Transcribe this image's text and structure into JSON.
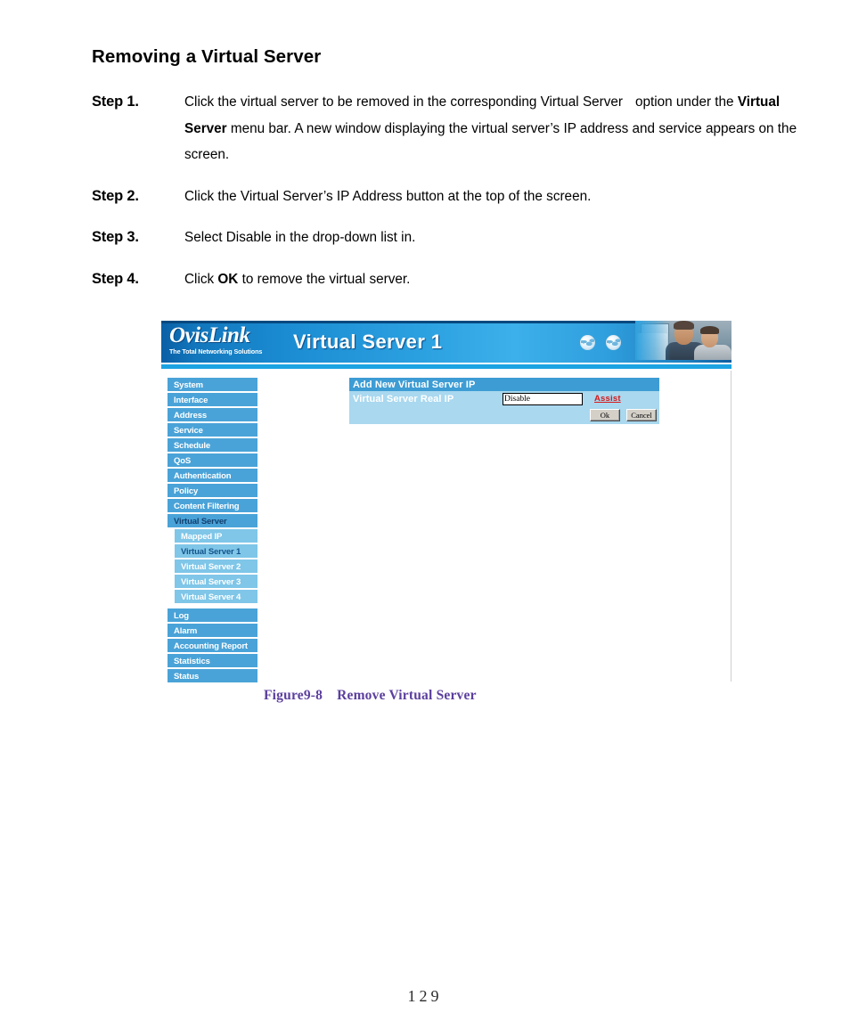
{
  "document": {
    "heading": "Removing a Virtual Server",
    "steps": [
      {
        "label": "Step 1.",
        "text_1": "Click the virtual server to be removed in the corresponding Virtual Server",
        "text_2": "option under the",
        "bold_1": "Virtual Server",
        "text_3": "menu bar. A new window displaying the virtual server’s IP address and service appears on the screen."
      },
      {
        "label": "Step 2.",
        "text_1": "Click the Virtual Server’s IP Address button at the top of the screen."
      },
      {
        "label": "Step 3.",
        "text_1": "Select Disable in the drop-down list in."
      },
      {
        "label": "Step 4.",
        "text_1": "Click",
        "bold_1": "OK",
        "text_2": "to remove the virtual server."
      }
    ],
    "figure_caption_number": "Figure9-8",
    "figure_caption_text": "Remove Virtual Server",
    "page_number": "129"
  },
  "screenshot": {
    "banner": {
      "logo_main": "OvisLink",
      "logo_tagline": "The Total Networking Solutions",
      "title": "Virtual Server 1",
      "icons": [
        "globe-icon",
        "globe-icon",
        "globe-icon",
        "globe-icon"
      ],
      "photo_alt": "man-and-boy-at-computer-photo"
    },
    "sidebar": {
      "items": [
        {
          "label": "System",
          "selected": false
        },
        {
          "label": "Interface",
          "selected": false
        },
        {
          "label": "Address",
          "selected": false
        },
        {
          "label": "Service",
          "selected": false
        },
        {
          "label": "Schedule",
          "selected": false
        },
        {
          "label": "QoS",
          "selected": false
        },
        {
          "label": "Authentication",
          "selected": false
        },
        {
          "label": "Policy",
          "selected": false
        },
        {
          "label": "Content Filtering",
          "selected": false
        },
        {
          "label": "Virtual Server",
          "selected": true
        }
      ],
      "submenu": [
        {
          "label": "Mapped IP",
          "selected": false
        },
        {
          "label": "Virtual Server 1",
          "selected": true
        },
        {
          "label": "Virtual Server 2",
          "selected": false
        },
        {
          "label": "Virtual Server 3",
          "selected": false
        },
        {
          "label": "Virtual Server 4",
          "selected": false
        }
      ],
      "items_after": [
        {
          "label": "Log",
          "selected": false
        },
        {
          "label": "Alarm",
          "selected": false
        },
        {
          "label": "Accounting Report",
          "selected": false
        },
        {
          "label": "Statistics",
          "selected": false
        },
        {
          "label": "Status",
          "selected": false
        }
      ]
    },
    "panel": {
      "header": "Add New Virtual Server IP",
      "row_label": "Virtual Server Real IP",
      "input_value": "Disable",
      "assist_label": "Assist",
      "ok_label": "Ok",
      "cancel_label": "Cancel"
    },
    "colors": {
      "menu_blue": "#4aa3d8",
      "submenu_blue": "#7fc6e8",
      "panel_header_blue": "#3d9cd4",
      "panel_row_blue": "#a9d8ef",
      "assist_red": "#d81818",
      "caption_purple": "#5b3f9e"
    }
  }
}
